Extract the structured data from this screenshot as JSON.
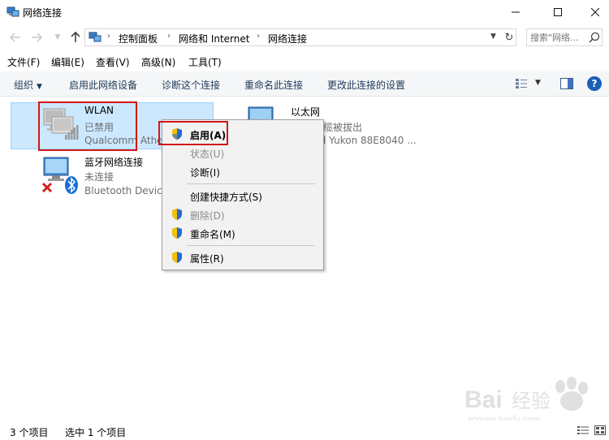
{
  "window": {
    "title": "网络连接",
    "minimize_label": "minimize",
    "maximize_label": "maximize",
    "close_label": "close"
  },
  "address_bar": {
    "breadcrumbs": [
      "控制面板",
      "网络和 Internet",
      "网络连接"
    ],
    "search_placeholder": "搜索\"网络..."
  },
  "menu": {
    "items": [
      "文件(F)",
      "编辑(E)",
      "查看(V)",
      "高级(N)",
      "工具(T)"
    ]
  },
  "command_bar": {
    "organize": "组织",
    "enable_device": "启用此网络设备",
    "diagnose": "诊断这个连接",
    "rename": "重命名此连接",
    "change_settings": "更改此连接的设置"
  },
  "connections": [
    {
      "name": "WLAN",
      "status": "已禁用",
      "device": "Qualcomm Athe",
      "selected": true,
      "icon": "wifi-adapter-icon"
    },
    {
      "name": "以太网",
      "status": "网络电缆被拔出",
      "device": "Marvell Yukon 88E8040 ...",
      "selected": false,
      "icon": "ethernet-adapter-icon",
      "status_visible": "缆被拔出",
      "device_visible": "l Yukon 88E8040 ..."
    },
    {
      "name": "蓝牙网络连接",
      "status": "未连接",
      "device": "Bluetooth Device",
      "selected": false,
      "icon": "bluetooth-adapter-icon"
    }
  ],
  "context_menu": {
    "items": [
      {
        "label": "启用(A)",
        "enabled": true,
        "bold": true,
        "shield": true
      },
      {
        "label": "状态(U)",
        "enabled": false,
        "bold": false,
        "shield": false
      },
      {
        "label": "诊断(I)",
        "enabled": true,
        "bold": false,
        "shield": false
      },
      {
        "label": "创建快捷方式(S)",
        "enabled": true,
        "bold": false,
        "shield": false
      },
      {
        "label": "删除(D)",
        "enabled": false,
        "bold": false,
        "shield": true
      },
      {
        "label": "重命名(M)",
        "enabled": true,
        "bold": false,
        "shield": true
      },
      {
        "label": "属性(R)",
        "enabled": true,
        "bold": false,
        "shield": true
      }
    ]
  },
  "status_bar": {
    "item_count": "3 个项目",
    "selected_count": "选中 1 个项目"
  },
  "watermark": {
    "text": "Bai 经验",
    "url": "jingyan.baidu.com"
  },
  "colors": {
    "selection_bg": "#cce8ff",
    "highlight_border": "#d01818",
    "command_text": "#1e395b",
    "help_blue": "#1b5fba"
  }
}
